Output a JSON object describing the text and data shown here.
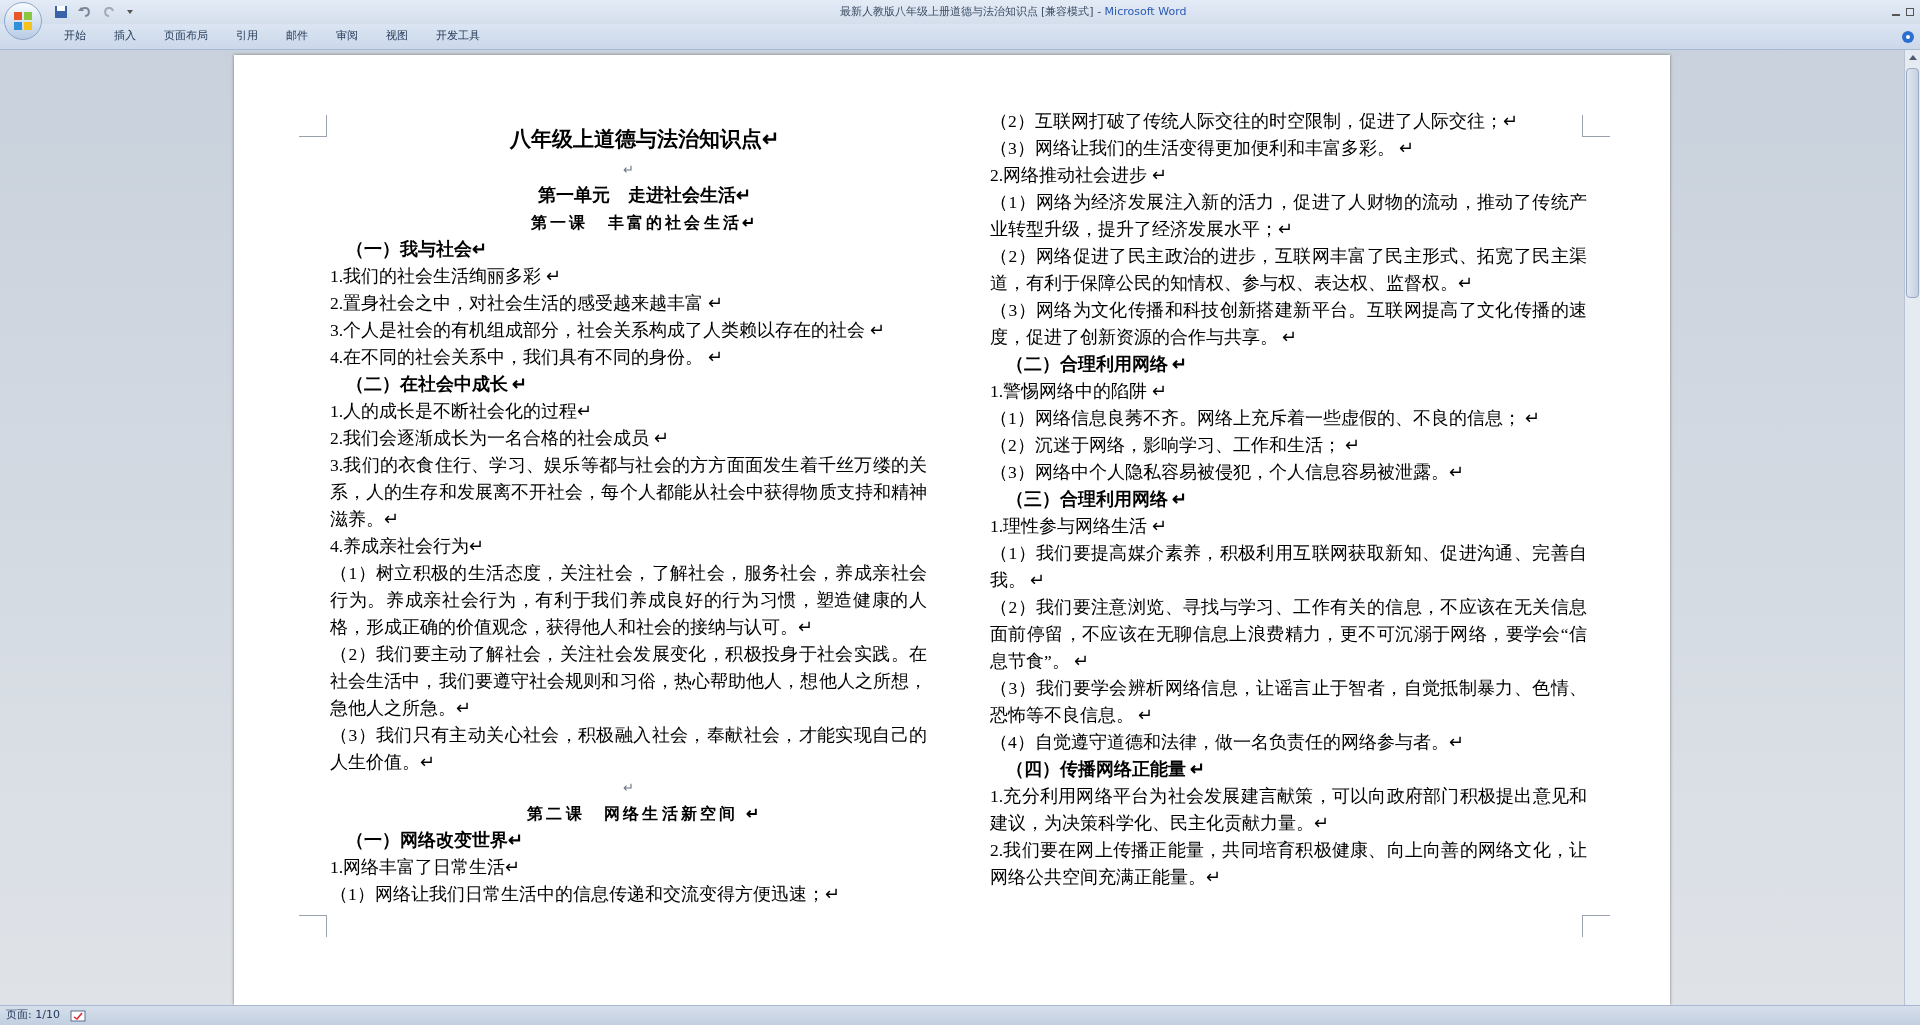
{
  "window": {
    "title": "最新人教版八年级上册道德与法治知识点 [兼容模式]",
    "separator": " - ",
    "app": "Microsoft Word"
  },
  "tabs": [
    {
      "label": "开始",
      "selected": false
    },
    {
      "label": "插入",
      "selected": false
    },
    {
      "label": "页面布局",
      "selected": false
    },
    {
      "label": "引用",
      "selected": false
    },
    {
      "label": "邮件",
      "selected": false
    },
    {
      "label": "审阅",
      "selected": false
    },
    {
      "label": "视图",
      "selected": false
    },
    {
      "label": "开发工具",
      "selected": false
    }
  ],
  "document": {
    "columns": [
      [
        {
          "kind": "title",
          "text": "八年级上道德与法治知识点↵"
        },
        {
          "kind": "blank",
          "text": "↵"
        },
        {
          "kind": "unit",
          "text": "第一单元　走进社会生活↵"
        },
        {
          "kind": "lesson",
          "text": "第一课　丰富的社会生活↵"
        },
        {
          "kind": "section",
          "text": "（一）我与社会↵"
        },
        {
          "kind": "text",
          "text": "1.我们的社会生活绚丽多彩 ↵"
        },
        {
          "kind": "text",
          "text": "2.置身社会之中，对社会生活的感受越来越丰富 ↵"
        },
        {
          "kind": "text",
          "text": "3.个人是社会的有机组成部分，社会关系构成了人类赖以存在的社会 ↵"
        },
        {
          "kind": "text",
          "text": "4.在不同的社会关系中，我们具有不同的身份。 ↵"
        },
        {
          "kind": "section",
          "text": "（二）在社会中成长 ↵"
        },
        {
          "kind": "text",
          "text": "1.人的成长是不断社会化的过程↵"
        },
        {
          "kind": "text",
          "text": "2.我们会逐渐成长为一名合格的社会成员 ↵"
        },
        {
          "kind": "text",
          "text": "3.我们的衣食住行、学习、娱乐等都与社会的方方面面发生着千丝万缕的关系，人的生存和发展离不开社会，每个人都能从社会中获得物质支持和精神滋养。↵"
        },
        {
          "kind": "text",
          "text": "4.养成亲社会行为↵"
        },
        {
          "kind": "text",
          "text": "（1）树立积极的生活态度，关注社会，了解社会，服务社会，养成亲社会行为。养成亲社会行为，有利于我们养成良好的行为习惯，塑造健康的人格，形成正确的价值观念，获得他人和社会的接纳与认可。↵"
        },
        {
          "kind": "text",
          "text": "（2）我们要主动了解社会，关注社会发展变化，积极投身于社会实践。在社会生活中，我们要遵守社会规则和习俗，热心帮助他人，想他人之所想，急他人之所急。↵"
        },
        {
          "kind": "text",
          "text": "（3）我们只有主动关心社会，积极融入社会，奉献社会，才能实现自己的人生价值。↵"
        },
        {
          "kind": "blank",
          "text": "↵"
        },
        {
          "kind": "lesson",
          "text": "第二课　网络生活新空间 ↵"
        },
        {
          "kind": "section",
          "text": "（一）网络改变世界↵"
        },
        {
          "kind": "text",
          "text": "1.网络丰富了日常生活↵"
        },
        {
          "kind": "text",
          "text": "（1）网络让我们日常生活中的信息传递和交流变得方便迅速；↵"
        }
      ],
      [
        {
          "kind": "text",
          "text": "（2）互联网打破了传统人际交往的时空限制，促进了人际交往；↵"
        },
        {
          "kind": "text",
          "text": "（3）网络让我们的生活变得更加便利和丰富多彩。 ↵"
        },
        {
          "kind": "text",
          "text": "2.网络推动社会进步 ↵"
        },
        {
          "kind": "text",
          "text": "（1）网络为经济发展注入新的活力，促进了人财物的流动，推动了传统产业转型升级，提升了经济发展水平；↵"
        },
        {
          "kind": "text",
          "text": "（2）网络促进了民主政治的进步，互联网丰富了民主形式、拓宽了民主渠道，有利于保障公民的知情权、参与权、表达权、监督权。↵"
        },
        {
          "kind": "text",
          "text": "（3）网络为文化传播和科技创新搭建新平台。互联网提高了文化传播的速度，促进了创新资源的合作与共享。 ↵"
        },
        {
          "kind": "section",
          "text": "（二）合理利用网络 ↵"
        },
        {
          "kind": "text",
          "text": "1.警惕网络中的陷阱 ↵"
        },
        {
          "kind": "text",
          "text": "（1）网络信息良莠不齐。网络上充斥着一些虚假的、不良的信息； ↵"
        },
        {
          "kind": "text",
          "text": "（2）沉迷于网络，影响学习、工作和生活； ↵"
        },
        {
          "kind": "text",
          "text": "（3）网络中个人隐私容易被侵犯，个人信息容易被泄露。↵"
        },
        {
          "kind": "section",
          "text": "（三）合理利用网络 ↵"
        },
        {
          "kind": "text",
          "text": "1.理性参与网络生活 ↵"
        },
        {
          "kind": "text",
          "text": "（1）我们要提高媒介素养，积极利用互联网获取新知、促进沟通、完善自我。 ↵"
        },
        {
          "kind": "text",
          "text": "（2）我们要注意浏览、寻找与学习、工作有关的信息，不应该在无关信息面前停留，不应该在无聊信息上浪费精力，更不可沉溺于网络，要学会“信息节食”。 ↵"
        },
        {
          "kind": "text",
          "text": "（3）我们要学会辨析网络信息，让谣言止于智者，自觉抵制暴力、色情、恐怖等不良信息。 ↵"
        },
        {
          "kind": "text",
          "text": "（4）自觉遵守道德和法律，做一名负责任的网络参与者。↵"
        },
        {
          "kind": "section",
          "text": "（四）传播网络正能量 ↵"
        },
        {
          "kind": "text",
          "text": "1.充分利用网络平台为社会发展建言献策，可以向政府部门积极提出意见和建议，为决策科学化、民主化贡献力量。↵"
        },
        {
          "kind": "text",
          "text": "2.我们要在网上传播正能量，共同培育积极健康、向上向善的网络文化，让网络公共空间充满正能量。↵"
        }
      ]
    ]
  },
  "status_bar": {
    "page": "页面: 1/10"
  }
}
